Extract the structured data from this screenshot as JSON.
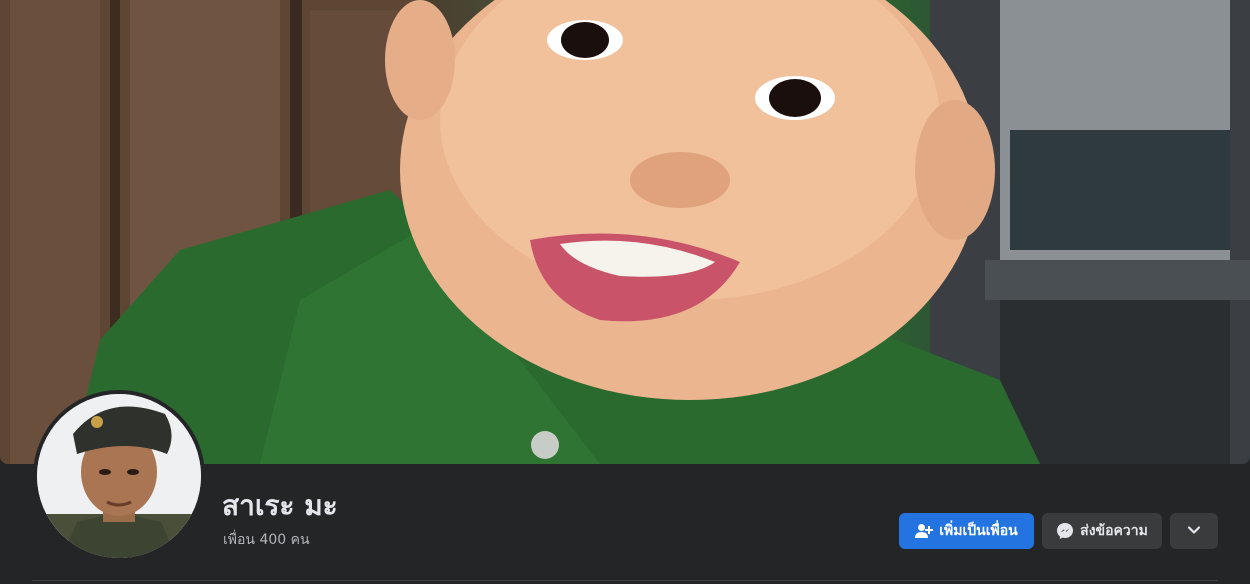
{
  "profile": {
    "name": "สาเระ มะ",
    "friends_count": "เพื่อน 400 คน"
  },
  "actions": {
    "add_friend_label": "เพิ่มเป็นเพื่อน",
    "message_label": "ส่งข้อความ",
    "more_icon": "chevron-down-icon"
  },
  "colors": {
    "background": "#242526",
    "primary_button": "#2374e1",
    "secondary_button": "#3a3b3c",
    "name_text": "#e4e6eb",
    "secondary_text": "#b0b3b8"
  }
}
